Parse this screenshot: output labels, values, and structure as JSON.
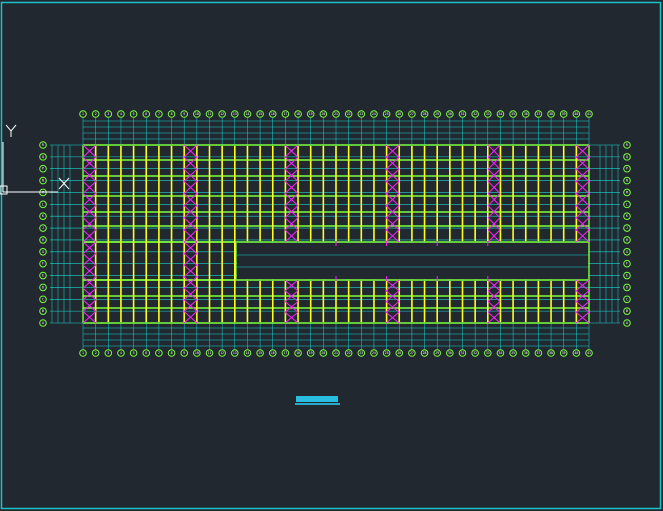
{
  "drawing": {
    "title": "",
    "background_color": "#212830",
    "frame_color": "#19c2c8"
  },
  "grid": {
    "column_axis_count": 41,
    "row_axis_labels": [
      "A",
      "B",
      "C",
      "D",
      "E",
      "F",
      "G",
      "H",
      "J",
      "K",
      "L",
      "M",
      "N",
      "P",
      "Q",
      "R"
    ],
    "bubble_color": "#7cff3c",
    "grid_line_color": "#18d8d0",
    "column_color": "#ffff1e",
    "beam_color": "#7cff3c",
    "bracing_color": "#ff1eff"
  },
  "ucs": {
    "y_label": "Y",
    "x_label": "X"
  }
}
